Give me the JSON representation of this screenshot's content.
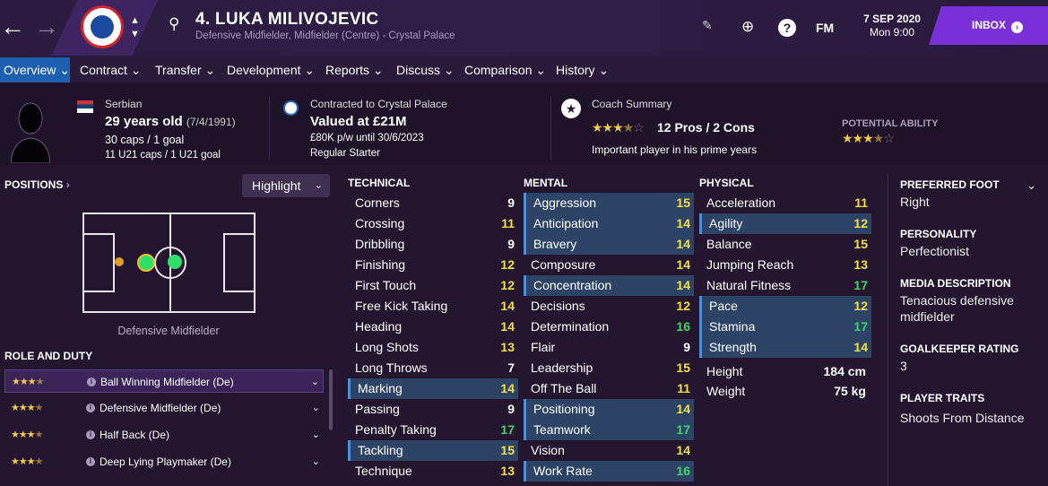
{
  "header": {
    "title": "4. LUKA MILIVOJEVIC",
    "subtitle": "Defensive Midfielder, Midfielder (Centre) - Crystal Palace",
    "brand": "FM",
    "date": "7 SEP 2020",
    "time": "Mon 9:00",
    "inbox": "INBOX"
  },
  "menu": [
    "Overview",
    "Contract",
    "Transfer",
    "Development",
    "Reports",
    "Discuss",
    "Comparison",
    "History"
  ],
  "profile": {
    "nationality": "Serbian",
    "age": "29 years old",
    "dob": "(7/4/1991)",
    "caps": "30 caps / 1 goal",
    "u21": "11 U21 caps / 1 U21 goal",
    "contract": "Contracted to Crystal Palace",
    "value": "Valued at £21M",
    "wage": "£80K p/w until 30/6/2023",
    "status": "Regular Starter",
    "coach_label": "Coach Summary",
    "pros_cons": "12 Pros / 2 Cons",
    "coach_text": "Important player in his prime years",
    "potential_label": "POTENTIAL ABILITY"
  },
  "left": {
    "positions_label": "POSITIONS",
    "highlight_label": "Highlight",
    "position_name": "Defensive Midfielder",
    "role_label": "ROLE AND DUTY",
    "roles": [
      "Ball Winning Midfielder (De)",
      "Defensive Midfielder (De)",
      "Half Back (De)",
      "Deep Lying Playmaker (De)"
    ]
  },
  "technical": {
    "label": "TECHNICAL",
    "items": [
      [
        "Corners",
        "9"
      ],
      [
        "Crossing",
        "11"
      ],
      [
        "Dribbling",
        "9"
      ],
      [
        "Finishing",
        "12"
      ],
      [
        "First Touch",
        "12"
      ],
      [
        "Free Kick Taking",
        "14"
      ],
      [
        "Heading",
        "14"
      ],
      [
        "Long Shots",
        "13"
      ],
      [
        "Long Throws",
        "7"
      ],
      [
        "Marking",
        "14"
      ],
      [
        "Passing",
        "9"
      ],
      [
        "Penalty Taking",
        "17"
      ],
      [
        "Tackling",
        "15"
      ],
      [
        "Technique",
        "13"
      ]
    ]
  },
  "mental": {
    "label": "MENTAL",
    "items": [
      [
        "Aggression",
        "15"
      ],
      [
        "Anticipation",
        "14"
      ],
      [
        "Bravery",
        "14"
      ],
      [
        "Composure",
        "14"
      ],
      [
        "Concentration",
        "14"
      ],
      [
        "Decisions",
        "12"
      ],
      [
        "Determination",
        "16"
      ],
      [
        "Flair",
        "9"
      ],
      [
        "Leadership",
        "15"
      ],
      [
        "Off The Ball",
        "11"
      ],
      [
        "Positioning",
        "14"
      ],
      [
        "Teamwork",
        "17"
      ],
      [
        "Vision",
        "14"
      ],
      [
        "Work Rate",
        "16"
      ]
    ]
  },
  "physical": {
    "label": "PHYSICAL",
    "items": [
      [
        "Acceleration",
        "11"
      ],
      [
        "Agility",
        "12"
      ],
      [
        "Balance",
        "15"
      ],
      [
        "Jumping Reach",
        "13"
      ],
      [
        "Natural Fitness",
        "17"
      ],
      [
        "Pace",
        "12"
      ],
      [
        "Stamina",
        "17"
      ],
      [
        "Strength",
        "14"
      ]
    ],
    "height_label": "Height",
    "height": "184 cm",
    "weight_label": "Weight",
    "weight": "75 kg"
  },
  "info": {
    "foot_label": "PREFERRED FOOT",
    "foot": "Right",
    "pers_label": "PERSONALITY",
    "pers": "Perfectionist",
    "media_label": "MEDIA DESCRIPTION",
    "media": "Tenacious defensive midfielder",
    "gk_label": "GOALKEEPER RATING",
    "gk": "3",
    "traits_label": "PLAYER TRAITS",
    "traits": "Shoots From Distance"
  }
}
